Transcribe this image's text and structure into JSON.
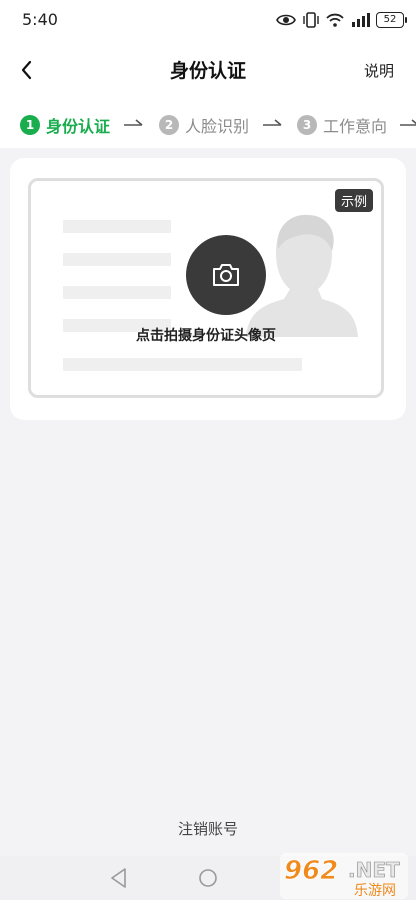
{
  "status_bar": {
    "time": "5:40",
    "battery": "52"
  },
  "nav": {
    "title": "身份认证",
    "help": "说明"
  },
  "steps": [
    {
      "num": "1",
      "label": "身份认证",
      "active": true
    },
    {
      "num": "2",
      "label": "人脸识别",
      "active": false
    },
    {
      "num": "3",
      "label": "工作意向",
      "active": false
    }
  ],
  "card": {
    "badge": "示例",
    "prompt": "点击拍摄身份证头像页"
  },
  "footer": {
    "cancel": "注销账号"
  },
  "watermark": {
    "number": "962",
    "suffix": ".NET",
    "site": "乐游网"
  },
  "colors": {
    "accent": "#1aad4e",
    "inactive": "#9e9e9e",
    "background": "#f3f3f5"
  },
  "icons": {
    "back": "chevron-left-icon",
    "camera": "camera-icon",
    "eye": "eye-icon",
    "vibrate": "vibrate-icon",
    "wifi": "wifi-icon",
    "signal": "signal-icon"
  }
}
